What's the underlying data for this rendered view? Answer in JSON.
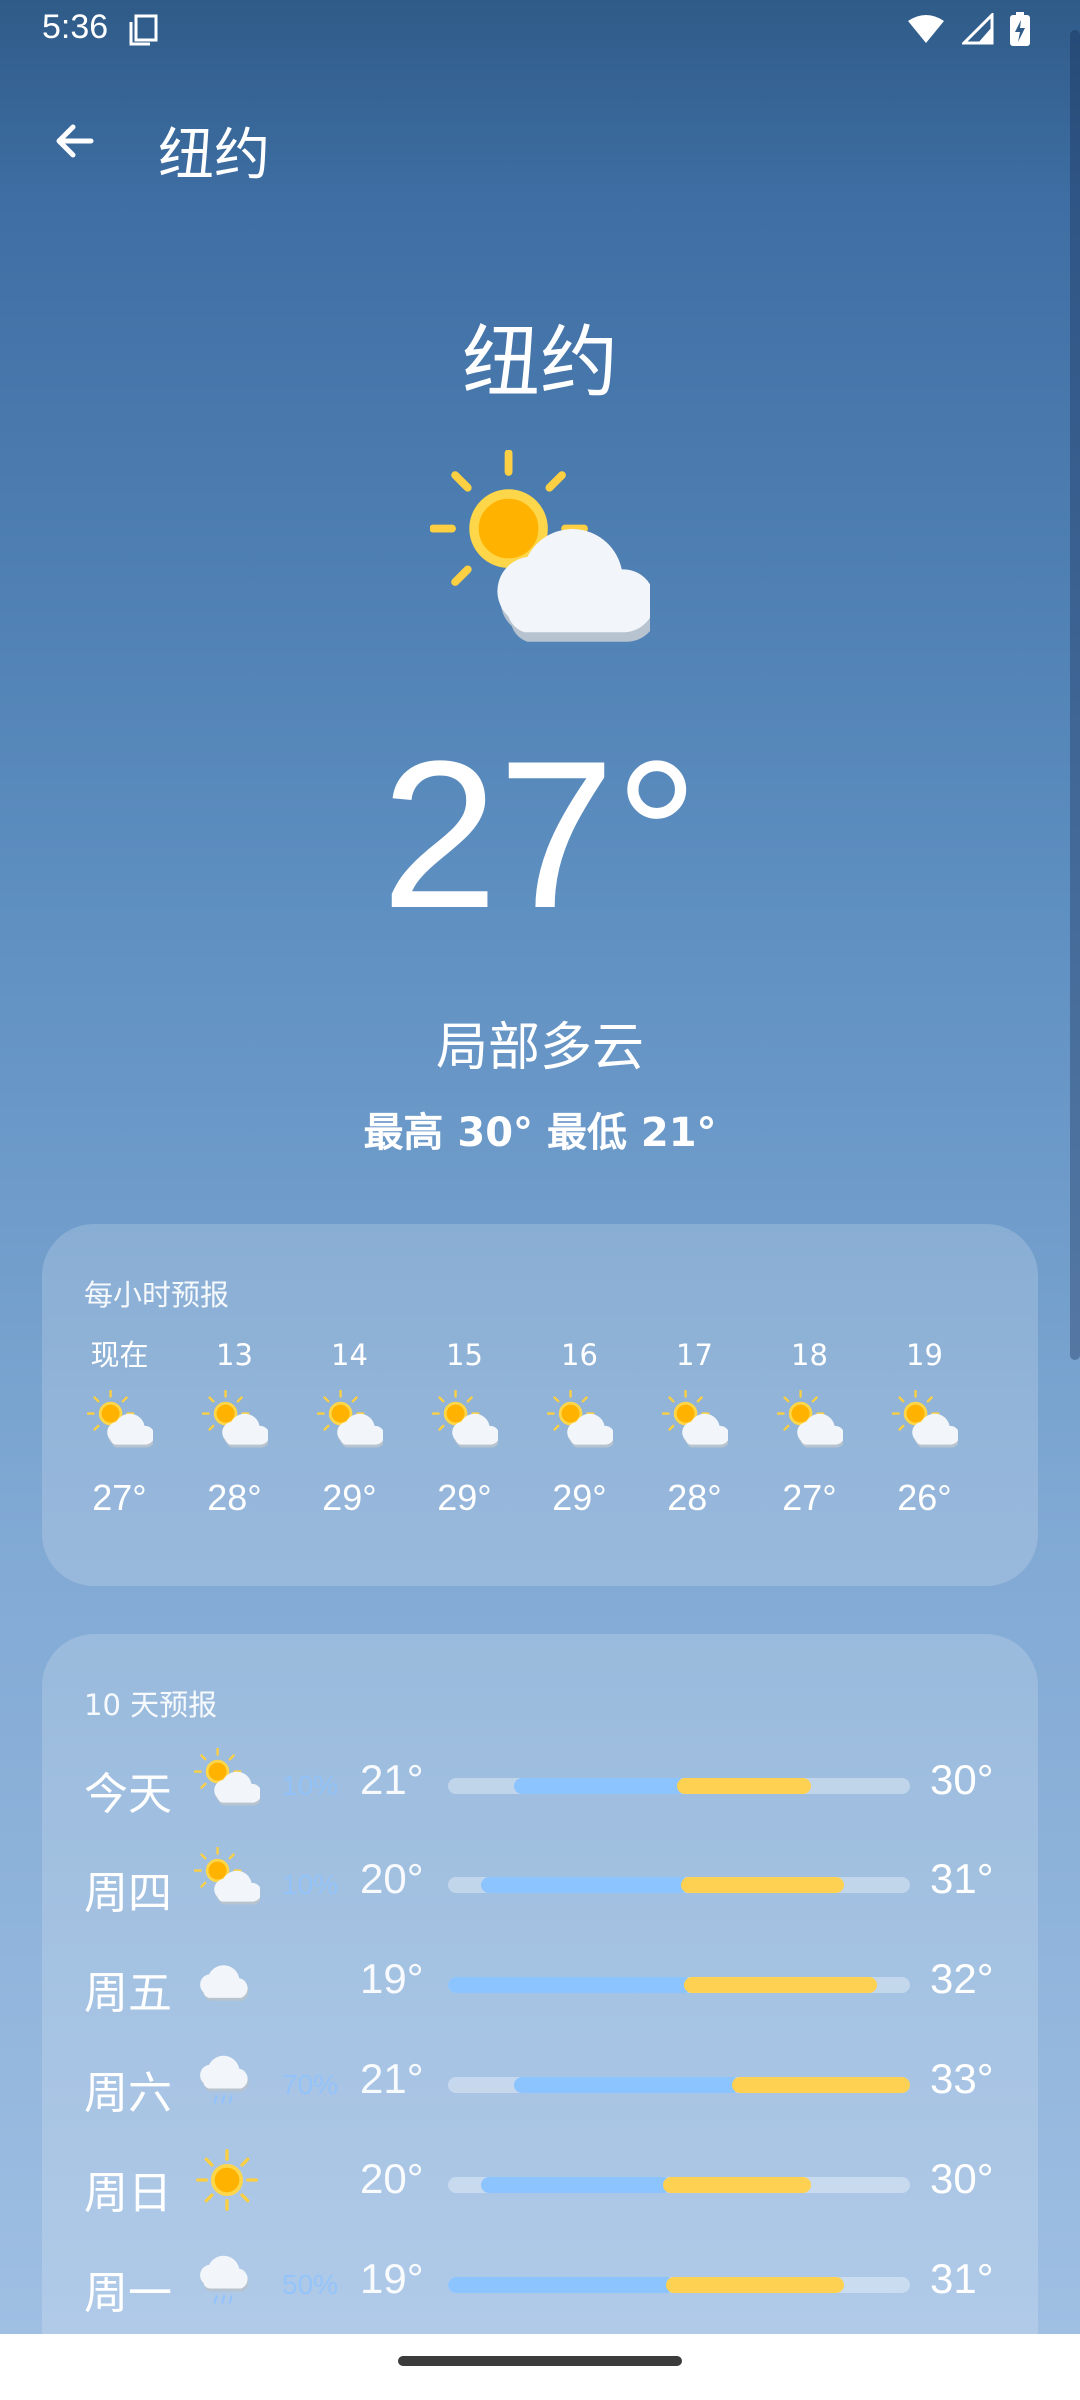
{
  "status_bar": {
    "time": "5:36",
    "icons": [
      "screenshot-icon",
      "wifi-icon",
      "signal-icon",
      "battery-charging-icon"
    ]
  },
  "app_bar": {
    "title": "纽约",
    "back_icon": "arrow-back-icon"
  },
  "current": {
    "city": "纽约",
    "icon": "partly-cloudy-icon",
    "temp": "27°",
    "condition": "局部多云",
    "high_low": "最高 30° 最低 21°"
  },
  "hourly": {
    "title": "每小时预报",
    "hours": [
      {
        "label": "现在",
        "icon": "partly-cloudy-icon",
        "temp": "27°"
      },
      {
        "label": "13",
        "icon": "partly-cloudy-icon",
        "temp": "28°"
      },
      {
        "label": "14",
        "icon": "partly-cloudy-icon",
        "temp": "29°"
      },
      {
        "label": "15",
        "icon": "partly-cloudy-icon",
        "temp": "29°"
      },
      {
        "label": "16",
        "icon": "partly-cloudy-icon",
        "temp": "29°"
      },
      {
        "label": "17",
        "icon": "partly-cloudy-icon",
        "temp": "28°"
      },
      {
        "label": "18",
        "icon": "partly-cloudy-icon",
        "temp": "27°"
      },
      {
        "label": "19",
        "icon": "partly-cloudy-icon",
        "temp": "26°"
      }
    ]
  },
  "daily": {
    "title": "10 天预报",
    "range_min": 19,
    "range_max": 33,
    "days": [
      {
        "name": "今天",
        "icon": "partly-cloudy-icon",
        "precip": "10%",
        "low": "21°",
        "high": "30°",
        "low_val": 21,
        "high_val": 30
      },
      {
        "name": "周四",
        "icon": "partly-cloudy-icon",
        "precip": "10%",
        "low": "20°",
        "high": "31°",
        "low_val": 20,
        "high_val": 31
      },
      {
        "name": "周五",
        "icon": "cloudy-icon",
        "precip": "",
        "low": "19°",
        "high": "32°",
        "low_val": 19,
        "high_val": 32
      },
      {
        "name": "周六",
        "icon": "rain-icon",
        "precip": "70%",
        "low": "21°",
        "high": "33°",
        "low_val": 21,
        "high_val": 33
      },
      {
        "name": "周日",
        "icon": "sunny-icon",
        "precip": "",
        "low": "20°",
        "high": "30°",
        "low_val": 20,
        "high_val": 30
      },
      {
        "name": "周一",
        "icon": "rain-icon",
        "precip": "50%",
        "low": "19°",
        "high": "31°",
        "low_val": 19,
        "high_val": 31
      }
    ]
  },
  "colors": {
    "bar_cool": "#8cc4ff",
    "bar_warm": "#ffd153",
    "sun": "#ffc107"
  }
}
